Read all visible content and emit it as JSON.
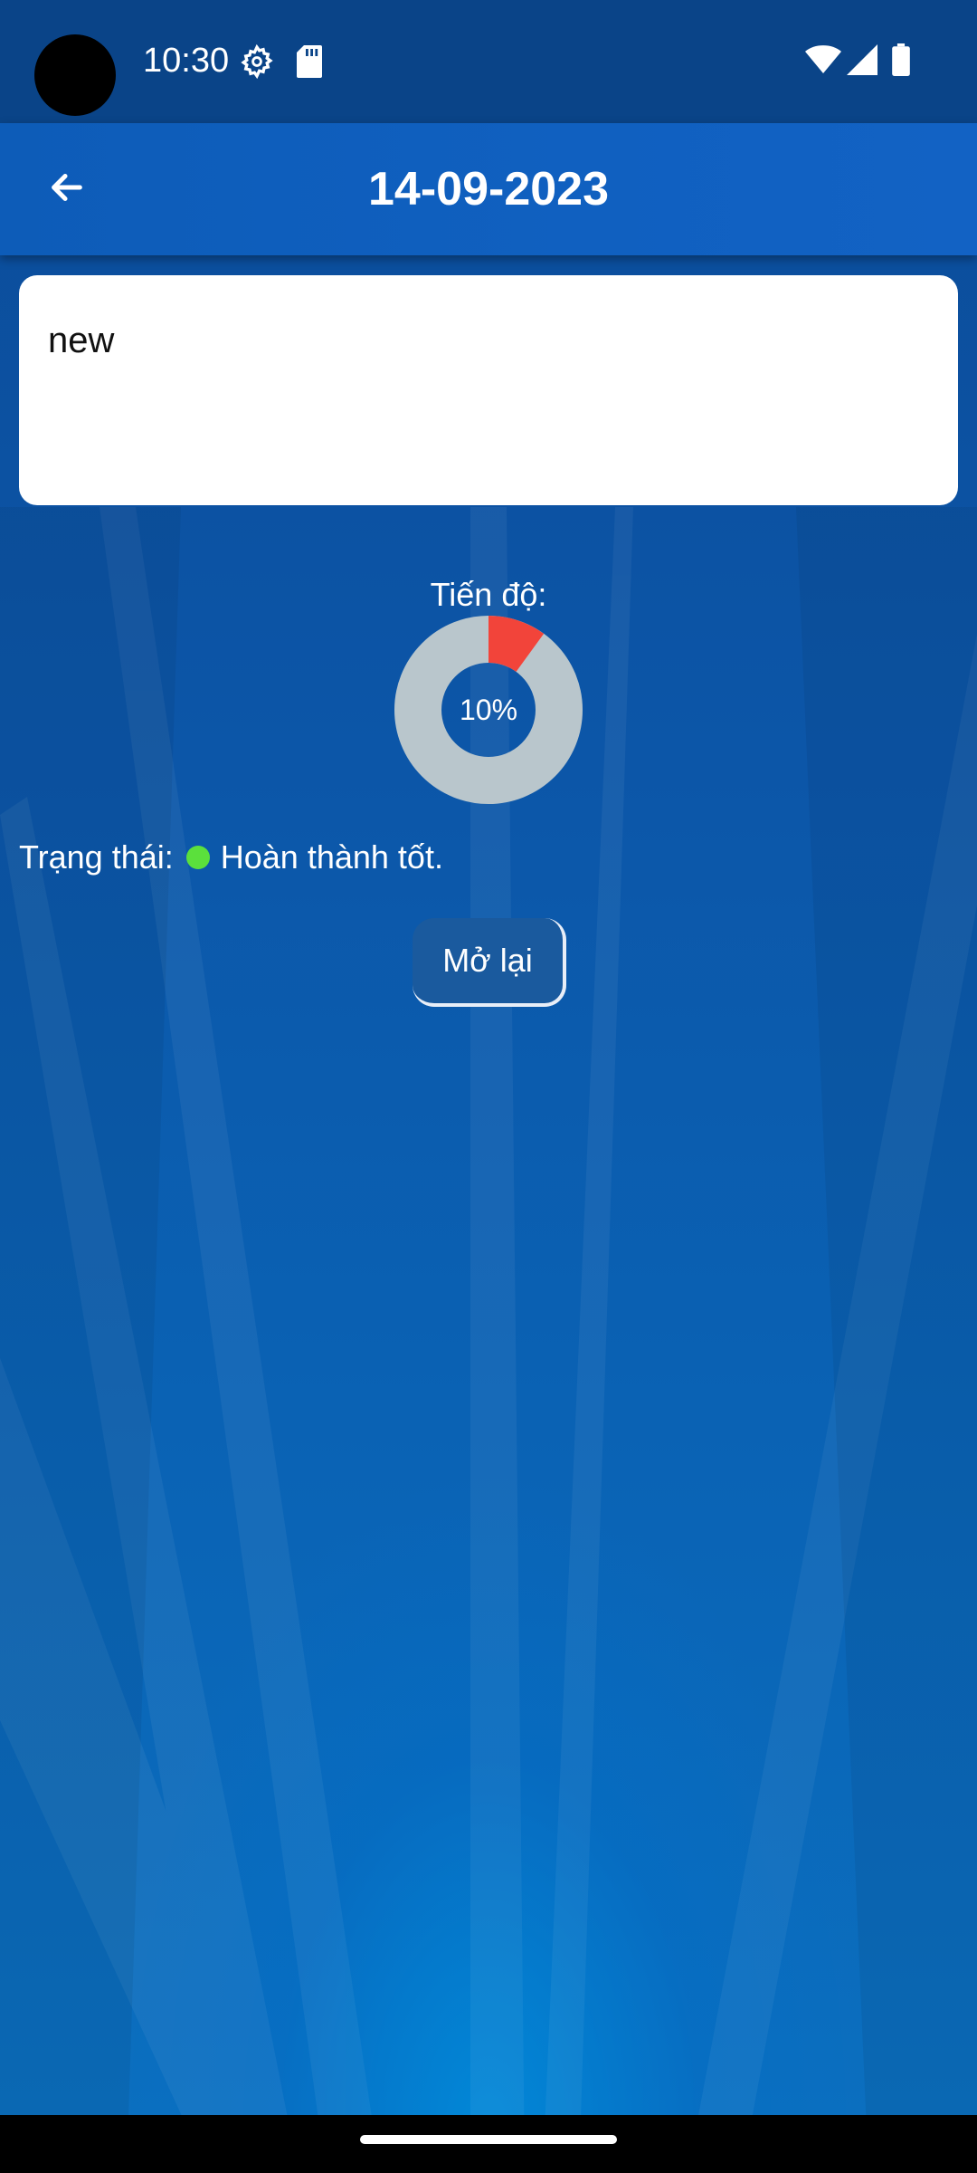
{
  "status_bar": {
    "time": "10:30",
    "icons": [
      "settings-gear-icon",
      "sd-card-icon",
      "wifi-icon",
      "cell-signal-icon",
      "battery-icon"
    ]
  },
  "app_bar": {
    "title": "14-09-2023",
    "back_icon": "arrow-left-icon"
  },
  "note": {
    "text": "new"
  },
  "progress": {
    "label": "Tiến độ:",
    "percent": 10,
    "percent_text": "10%",
    "filled_color": "#f2443a",
    "track_color": "#b9c6cc"
  },
  "status": {
    "label": "Trạng thái:",
    "value": "Hoàn thành tốt.",
    "dot_color": "#5be03c"
  },
  "actions": {
    "reopen_label": "Mở lại"
  }
}
